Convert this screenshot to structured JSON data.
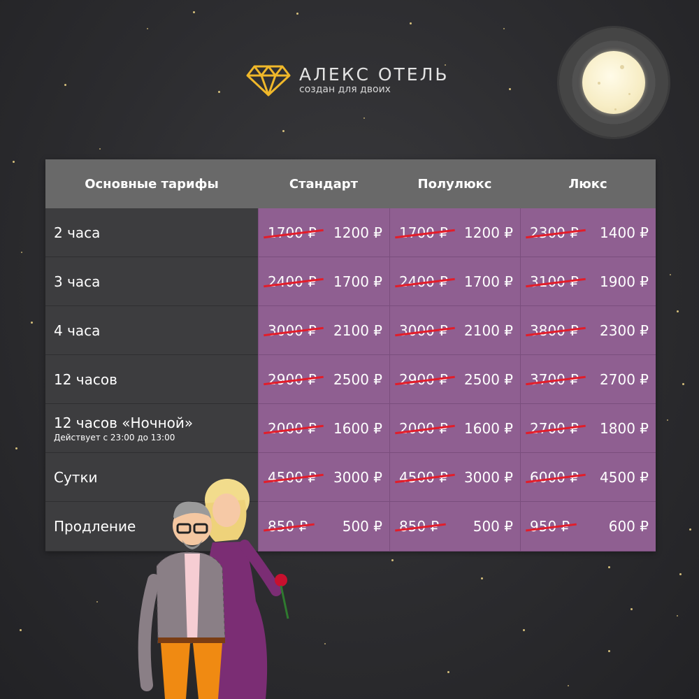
{
  "brand": {
    "name": "АЛЕКС ОТЕЛЬ",
    "tagline": "создан для двоих",
    "logo_icon": "diamond-icon"
  },
  "colors": {
    "accent_gold": "#f0b82a",
    "cell_purple": "#8f5f91",
    "strike_red": "#e21d2a",
    "header_gray": "#696969"
  },
  "table": {
    "headers": [
      "Основные тарифы",
      "Стандарт",
      "Полулюкс",
      "Люкс"
    ],
    "rows": [
      {
        "label": "2 часа",
        "note": "",
        "prices": [
          {
            "old": "1700 ₽",
            "new": "1200 ₽"
          },
          {
            "old": "1700 ₽",
            "new": "1200 ₽"
          },
          {
            "old": "2300 ₽",
            "new": "1400 ₽"
          }
        ]
      },
      {
        "label": "3 часа",
        "note": "",
        "prices": [
          {
            "old": "2400 ₽",
            "new": "1700 ₽"
          },
          {
            "old": "2400 ₽",
            "new": "1700 ₽"
          },
          {
            "old": "3100 ₽",
            "new": "1900 ₽"
          }
        ]
      },
      {
        "label": "4 часа",
        "note": "",
        "prices": [
          {
            "old": "3000 ₽",
            "new": "2100 ₽"
          },
          {
            "old": "3000 ₽",
            "new": "2100 ₽"
          },
          {
            "old": "3800 ₽",
            "new": "2300 ₽"
          }
        ]
      },
      {
        "label": "12 часов",
        "note": "",
        "prices": [
          {
            "old": "2900 ₽",
            "new": "2500 ₽"
          },
          {
            "old": "2900 ₽",
            "new": "2500 ₽"
          },
          {
            "old": "3700 ₽",
            "new": "2700 ₽"
          }
        ]
      },
      {
        "label": "12 часов «Ночной»",
        "note": "Действует с 23:00 до 13:00",
        "prices": [
          {
            "old": "2000 ₽",
            "new": "1600 ₽"
          },
          {
            "old": "2000 ₽",
            "new": "1600 ₽"
          },
          {
            "old": "2700 ₽",
            "new": "1800 ₽"
          }
        ]
      },
      {
        "label": "Сутки",
        "note": "",
        "prices": [
          {
            "old": "4500 ₽",
            "new": "3000 ₽"
          },
          {
            "old": "4500 ₽",
            "new": "3000 ₽"
          },
          {
            "old": "6000 ₽",
            "new": "4500 ₽"
          }
        ]
      },
      {
        "label": "Продление",
        "note": "",
        "prices": [
          {
            "old": "850 ₽",
            "new": "500 ₽"
          },
          {
            "old": "850 ₽",
            "new": "500 ₽"
          },
          {
            "old": "950 ₽",
            "new": "600 ₽"
          }
        ]
      }
    ]
  },
  "illustration": {
    "icon": "couple-illustration"
  },
  "decor": {
    "moon_icon": "moon-icon",
    "star_icon": "star-icon"
  }
}
